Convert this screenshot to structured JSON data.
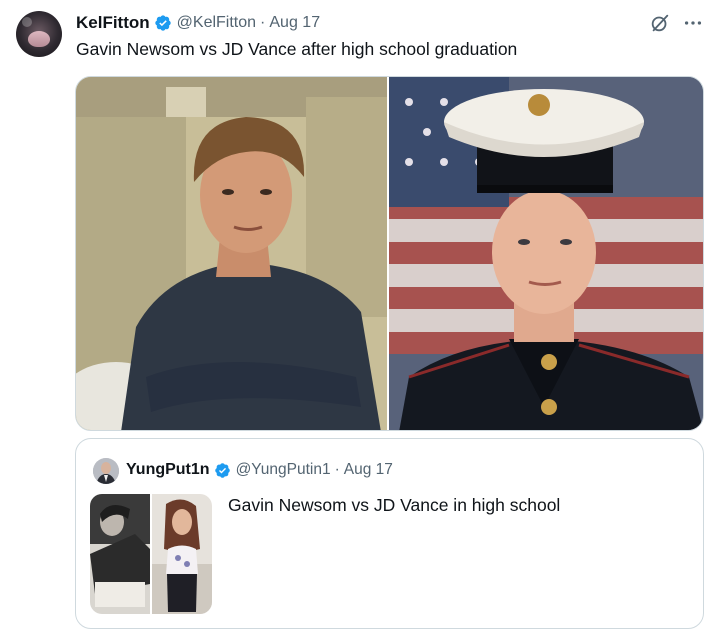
{
  "tweet": {
    "author_name": "KelFitton",
    "author_handle": "@KelFitton",
    "separator": "·",
    "date": "Aug 17",
    "text": "Gavin Newsom vs JD Vance after high school graduation",
    "verified_color": "#1d9bf0"
  },
  "quoted_tweet": {
    "author_name": "YungPut1n",
    "author_handle": "@YungPutin1",
    "separator": "·",
    "date": "Aug 17",
    "text": "Gavin Newsom vs JD Vance in high school"
  },
  "icons": {
    "verified": "verified-badge-icon",
    "grok": "grok-icon",
    "more": "more-options-icon"
  },
  "colors": {
    "text_primary": "#0f1419",
    "text_secondary": "#536471",
    "border": "#cfd9de"
  }
}
